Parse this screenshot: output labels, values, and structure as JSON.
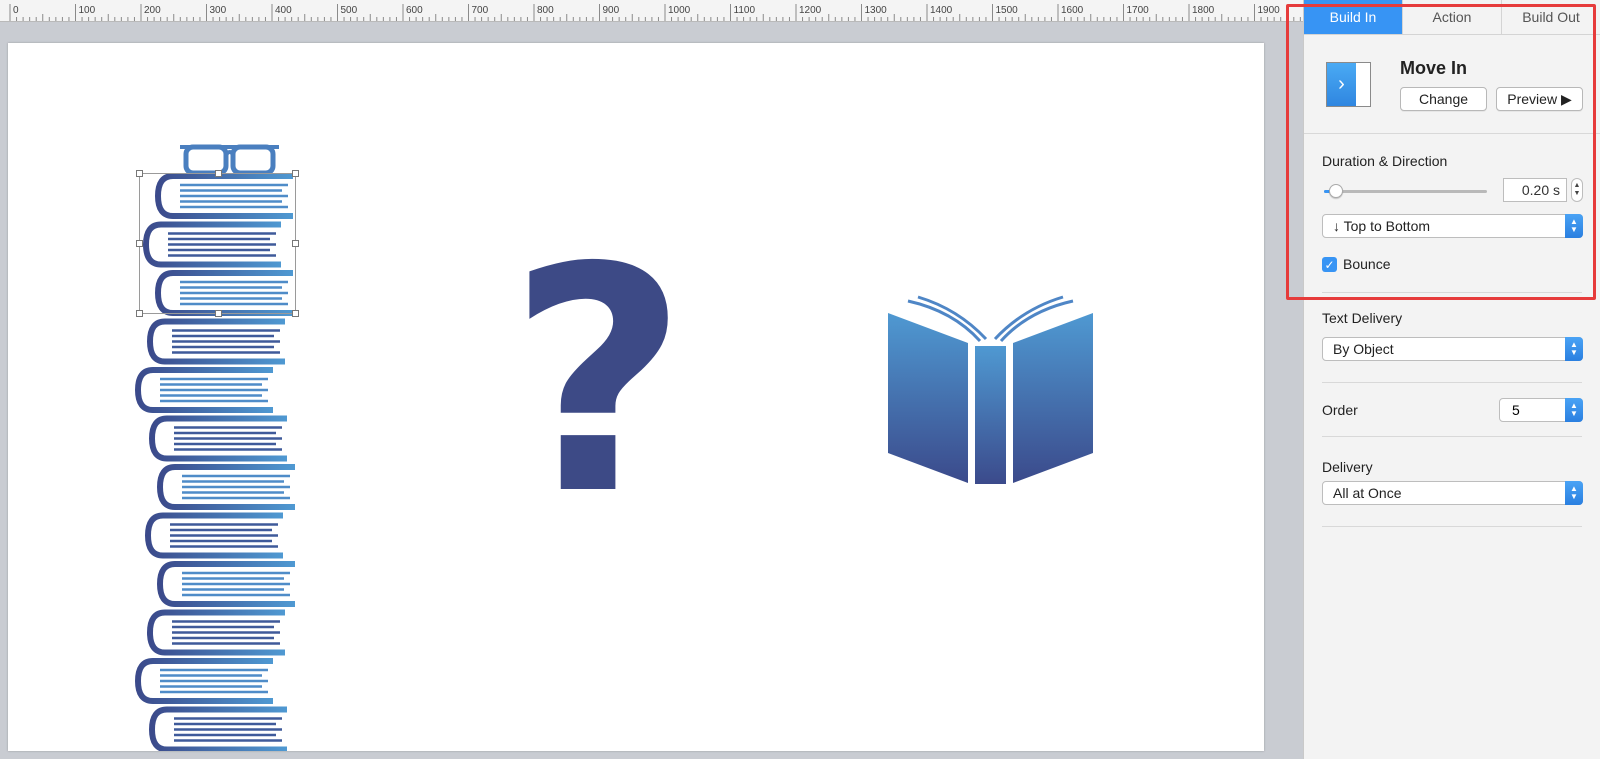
{
  "ruler": {
    "labels": [
      "0",
      "100",
      "200",
      "300",
      "400",
      "500",
      "600",
      "700",
      "800",
      "900",
      "1000",
      "1100",
      "1200",
      "1300",
      "1400",
      "1500",
      "1600",
      "1700",
      "1800",
      "1900"
    ]
  },
  "inspector": {
    "tabs": [
      {
        "label": "Build In",
        "active": true
      },
      {
        "label": "Action",
        "active": false
      },
      {
        "label": "Build Out",
        "active": false
      }
    ],
    "effect": {
      "title": "Move In",
      "change_label": "Change",
      "preview_label": "Preview ▶"
    },
    "duration": {
      "heading": "Duration & Direction",
      "value_text": "0.20 s",
      "slider_fraction": 0.05,
      "direction": "↓   Top to Bottom",
      "bounce_label": "Bounce",
      "bounce_checked": true
    },
    "text_delivery": {
      "heading": "Text Delivery",
      "value": "By Object"
    },
    "order": {
      "heading": "Order",
      "value": "5"
    },
    "delivery": {
      "heading": "Delivery",
      "value": "All at Once"
    }
  },
  "colors": {
    "accent": "#3794f4",
    "highlight": "#e63b3b",
    "book_blue_light": "#4e97cf",
    "book_blue_dark": "#3d4b8a"
  },
  "slide": {
    "question_mark": "?"
  }
}
